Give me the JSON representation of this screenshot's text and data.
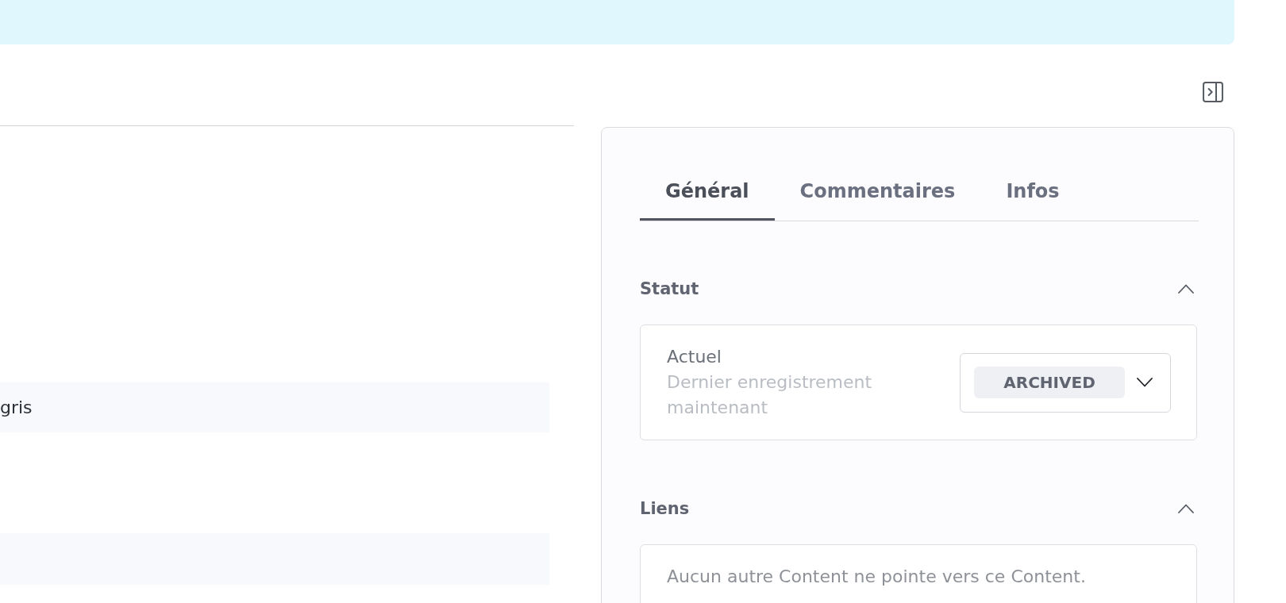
{
  "left_panel": {
    "rows": [
      {
        "text": "gris"
      },
      {}
    ]
  },
  "side_panel": {
    "tabs": [
      {
        "label": "Général",
        "selected": true
      },
      {
        "label": "Commentaires",
        "selected": false
      },
      {
        "label": "Infos",
        "selected": false
      }
    ],
    "sections": [
      {
        "kind": "status",
        "title": "Statut",
        "expanded": true,
        "label": "Actuel",
        "hint": "Dernier enregistrement maintenant",
        "value": "ARCHIVED"
      },
      {
        "kind": "links",
        "title": "Liens",
        "expanded": true,
        "message": "Aucun autre Content ne pointe vers ce Content."
      }
    ]
  }
}
